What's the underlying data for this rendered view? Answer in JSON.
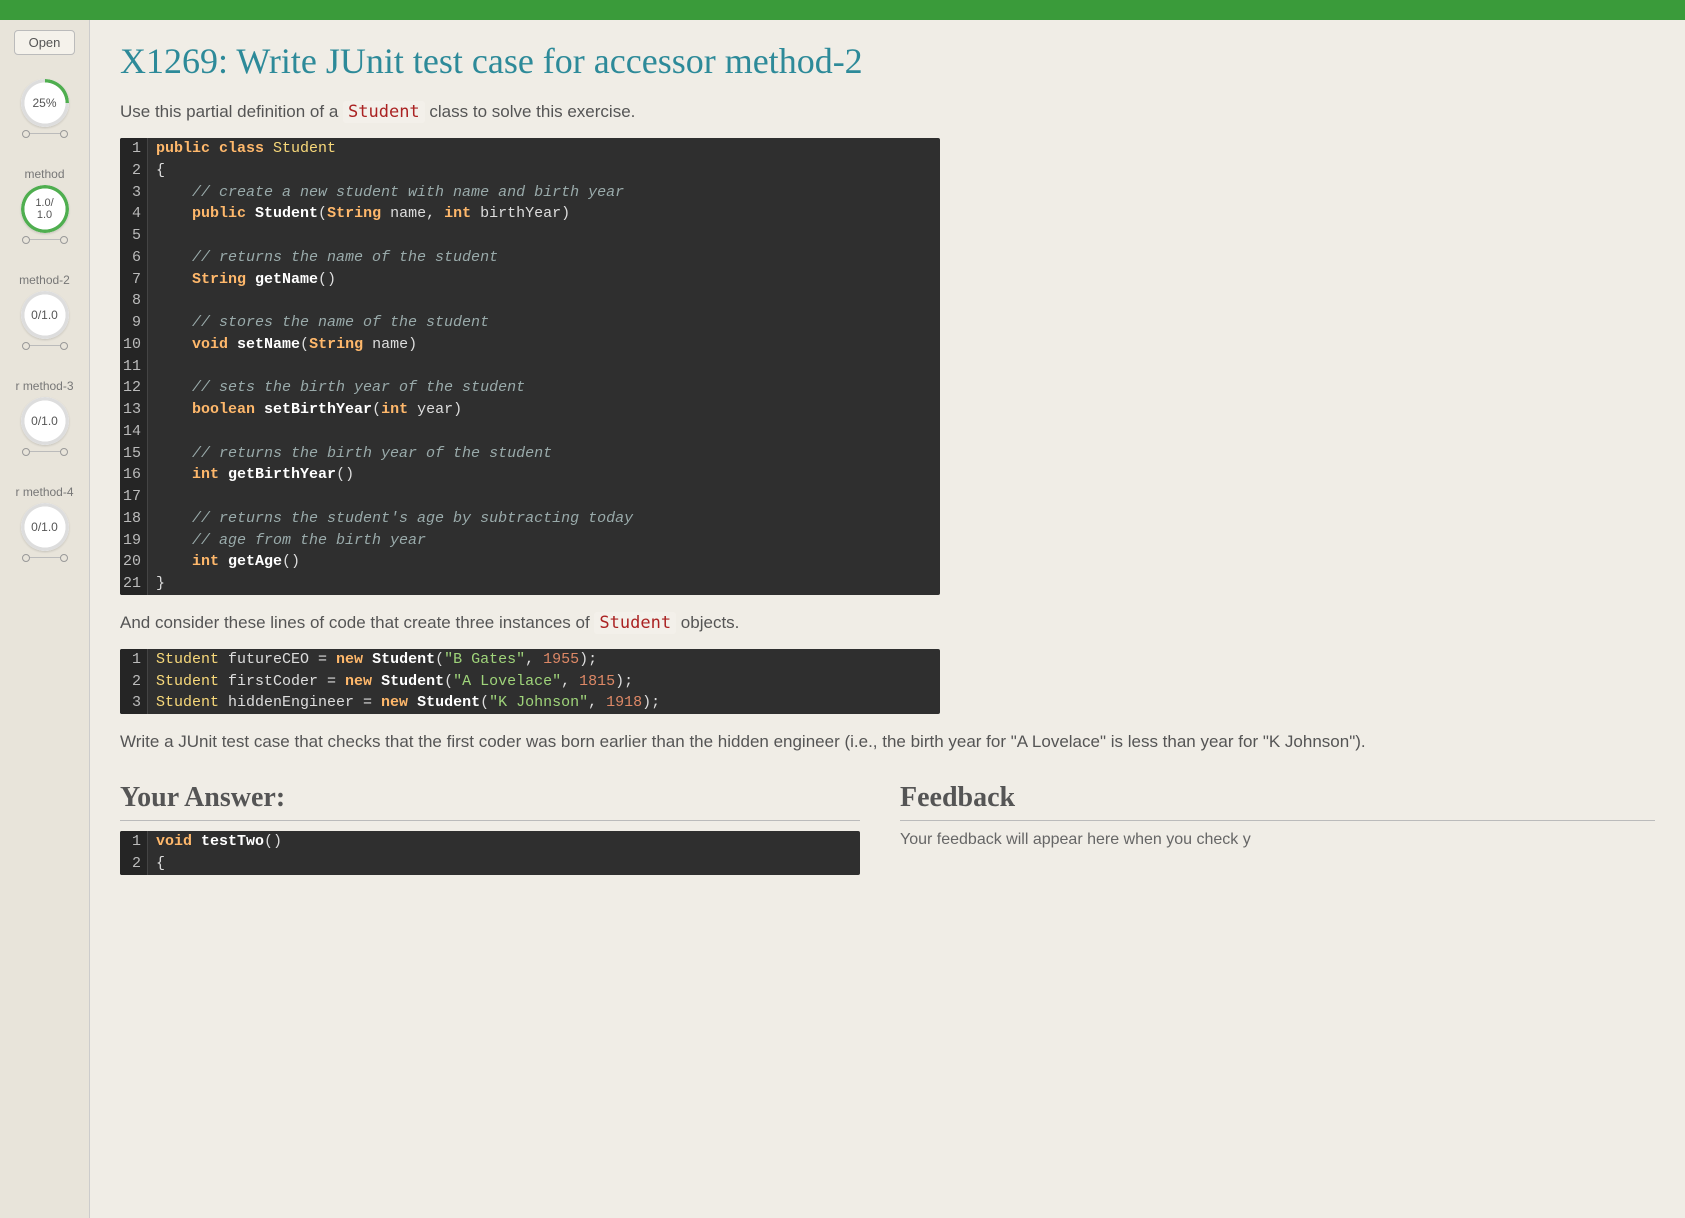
{
  "title": "X1269: Write JUnit test case for accessor method-2",
  "intro_prefix": "Use this partial definition of a ",
  "intro_code": "Student",
  "intro_suffix": " class to solve this exercise.",
  "sidebar": {
    "open": "Open",
    "items": [
      {
        "label": "",
        "score": "25%",
        "ring": "ring-25"
      },
      {
        "label": "method",
        "score": "1.0/\n1.0",
        "ring": "ring-100"
      },
      {
        "label": "method-2",
        "score": "0/1.0",
        "ring": "ring-0"
      },
      {
        "label": "r method-3",
        "score": "0/1.0",
        "ring": "ring-0"
      },
      {
        "label": "r method-4",
        "score": "0/1.0",
        "ring": "ring-0"
      }
    ]
  },
  "code1": [
    {
      "n": "1",
      "tokens": [
        [
          "kw",
          "public "
        ],
        [
          "kw",
          "class "
        ],
        [
          "cls",
          "Student"
        ]
      ]
    },
    {
      "n": "2",
      "tokens": [
        [
          "",
          "{"
        ]
      ]
    },
    {
      "n": "3",
      "tokens": [
        [
          "",
          "    "
        ],
        [
          "cm",
          "// create a new student with name and birth year"
        ]
      ]
    },
    {
      "n": "4",
      "tokens": [
        [
          "",
          "    "
        ],
        [
          "kw",
          "public "
        ],
        [
          "fn",
          "Student"
        ],
        [
          "",
          "("
        ],
        [
          "type",
          "String "
        ],
        [
          "",
          "name, "
        ],
        [
          "kw",
          "int "
        ],
        [
          "",
          "birthYear)"
        ]
      ]
    },
    {
      "n": "5",
      "tokens": [
        [
          "",
          ""
        ]
      ]
    },
    {
      "n": "6",
      "tokens": [
        [
          "",
          "    "
        ],
        [
          "cm",
          "// returns the name of the student"
        ]
      ]
    },
    {
      "n": "7",
      "tokens": [
        [
          "",
          "    "
        ],
        [
          "type",
          "String "
        ],
        [
          "fn",
          "getName"
        ],
        [
          "",
          "()"
        ]
      ]
    },
    {
      "n": "8",
      "tokens": [
        [
          "",
          ""
        ]
      ]
    },
    {
      "n": "9",
      "tokens": [
        [
          "",
          "    "
        ],
        [
          "cm",
          "// stores the name of the student"
        ]
      ]
    },
    {
      "n": "10",
      "tokens": [
        [
          "",
          "    "
        ],
        [
          "kw",
          "void "
        ],
        [
          "fn",
          "setName"
        ],
        [
          "",
          "("
        ],
        [
          "type",
          "String "
        ],
        [
          "",
          "name)"
        ]
      ]
    },
    {
      "n": "11",
      "tokens": [
        [
          "",
          ""
        ]
      ]
    },
    {
      "n": "12",
      "tokens": [
        [
          "",
          "    "
        ],
        [
          "cm",
          "// sets the birth year of the student"
        ]
      ]
    },
    {
      "n": "13",
      "tokens": [
        [
          "",
          "    "
        ],
        [
          "kw",
          "boolean "
        ],
        [
          "fn",
          "setBirthYear"
        ],
        [
          "",
          "("
        ],
        [
          "kw",
          "int "
        ],
        [
          "",
          "year)"
        ]
      ]
    },
    {
      "n": "14",
      "tokens": [
        [
          "",
          ""
        ]
      ]
    },
    {
      "n": "15",
      "tokens": [
        [
          "",
          "    "
        ],
        [
          "cm",
          "// returns the birth year of the student"
        ]
      ]
    },
    {
      "n": "16",
      "tokens": [
        [
          "",
          "    "
        ],
        [
          "kw",
          "int "
        ],
        [
          "fn",
          "getBirthYear"
        ],
        [
          "",
          "()"
        ]
      ]
    },
    {
      "n": "17",
      "tokens": [
        [
          "",
          ""
        ]
      ]
    },
    {
      "n": "18",
      "tokens": [
        [
          "",
          "    "
        ],
        [
          "cm",
          "// returns the student's age by subtracting today"
        ]
      ]
    },
    {
      "n": "19",
      "tokens": [
        [
          "",
          "    "
        ],
        [
          "cm",
          "// age from the birth year"
        ]
      ]
    },
    {
      "n": "20",
      "tokens": [
        [
          "",
          "    "
        ],
        [
          "kw",
          "int "
        ],
        [
          "fn",
          "getAge"
        ],
        [
          "",
          "()"
        ]
      ]
    },
    {
      "n": "21",
      "tokens": [
        [
          "",
          "}"
        ]
      ]
    }
  ],
  "mid_prefix": "And consider these lines of code that create three instances of ",
  "mid_code": "Student",
  "mid_suffix": " objects.",
  "code2": [
    {
      "n": "1",
      "tokens": [
        [
          "cls",
          "Student "
        ],
        [
          "",
          "futureCEO = "
        ],
        [
          "kw",
          "new "
        ],
        [
          "fn",
          "Student"
        ],
        [
          "",
          "("
        ],
        [
          "str",
          "\"B Gates\""
        ],
        [
          "",
          ", "
        ],
        [
          "num",
          "1955"
        ],
        [
          "",
          ");"
        ]
      ]
    },
    {
      "n": "2",
      "tokens": [
        [
          "cls",
          "Student "
        ],
        [
          "",
          "firstCoder = "
        ],
        [
          "kw",
          "new "
        ],
        [
          "fn",
          "Student"
        ],
        [
          "",
          "("
        ],
        [
          "str",
          "\"A Lovelace\""
        ],
        [
          "",
          ", "
        ],
        [
          "num",
          "1815"
        ],
        [
          "",
          ");"
        ]
      ]
    },
    {
      "n": "3",
      "tokens": [
        [
          "cls",
          "Student "
        ],
        [
          "",
          "hiddenEngineer = "
        ],
        [
          "kw",
          "new "
        ],
        [
          "fn",
          "Student"
        ],
        [
          "",
          "("
        ],
        [
          "str",
          "\"K Johnson\""
        ],
        [
          "",
          ", "
        ],
        [
          "num",
          "1918"
        ],
        [
          "",
          ");"
        ]
      ]
    }
  ],
  "task": "Write a JUnit test case that checks that the first coder was born earlier than the hidden engineer (i.e., the birth year for \"A Lovelace\" is less than year for \"K Johnson\").",
  "answer_heading": "Your Answer:",
  "feedback_heading": "Feedback",
  "feedback_text": "Your feedback will appear here when you check y",
  "code3": [
    {
      "n": "1",
      "tokens": [
        [
          "kw",
          "void "
        ],
        [
          "fn",
          "testTwo"
        ],
        [
          "",
          "()"
        ]
      ]
    },
    {
      "n": "2",
      "tokens": [
        [
          "",
          "{"
        ]
      ]
    }
  ]
}
